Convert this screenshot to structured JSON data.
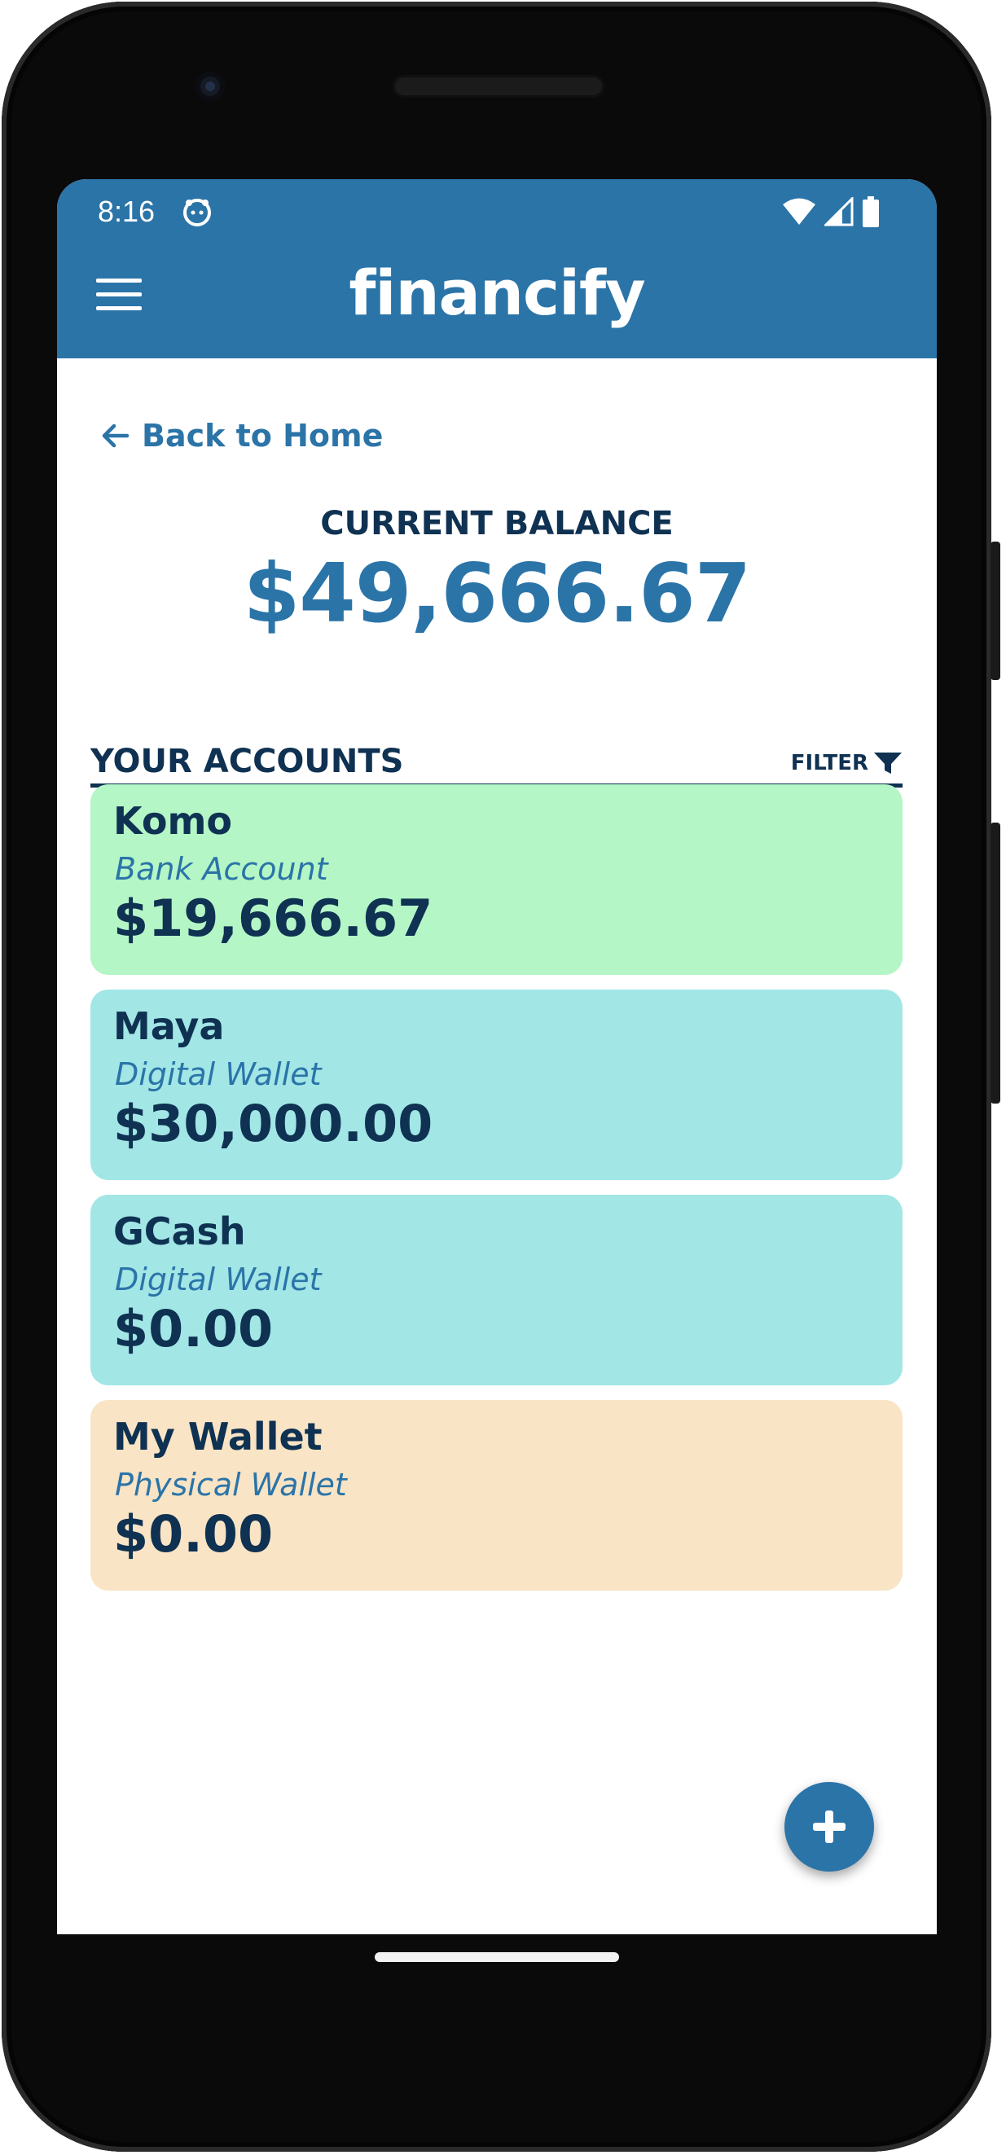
{
  "status_bar": {
    "time": "8:16"
  },
  "app_bar": {
    "title": "financify"
  },
  "navigation": {
    "back_label": "Back to Home"
  },
  "balance": {
    "label": "CURRENT BALANCE",
    "value": "$49,666.67"
  },
  "accounts_section": {
    "title": "YOUR ACCOUNTS",
    "filter_label": "FILTER"
  },
  "accounts": [
    {
      "name": "Komo",
      "type": "Bank Account",
      "balance": "$19,666.67",
      "color": "#b4f6c6"
    },
    {
      "name": "Maya",
      "type": "Digital Wallet",
      "balance": "$30,000.00",
      "color": "#a2e6e6"
    },
    {
      "name": "GCash",
      "type": "Digital Wallet",
      "balance": "$0.00",
      "color": "#a2e6e6"
    },
    {
      "name": "My Wallet",
      "type": "Physical Wallet",
      "balance": "$0.00",
      "color": "#f9e4c5"
    }
  ],
  "colors": {
    "primary": "#2b74a8",
    "dark_text": "#0f3152"
  },
  "icons": {
    "menu": "hamburger-icon",
    "back": "arrow-left-icon",
    "filter": "funnel-icon",
    "add": "plus-icon"
  }
}
